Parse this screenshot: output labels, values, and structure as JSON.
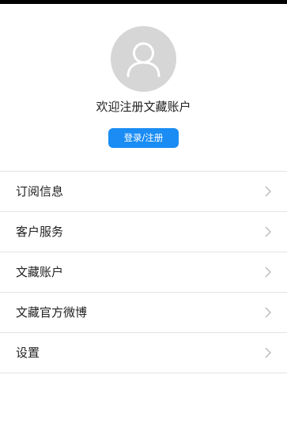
{
  "profile": {
    "avatar_icon": "user-icon",
    "welcome_text": "欢迎注册文藏账户",
    "login_button_label": "登录/注册",
    "accent_color": "#1a8cf3"
  },
  "menu": {
    "items": [
      {
        "label": "订阅信息",
        "icon": "chevron-right-icon"
      },
      {
        "label": "客户服务",
        "icon": "chevron-right-icon"
      },
      {
        "label": "文藏账户",
        "icon": "chevron-right-icon"
      },
      {
        "label": "文藏官方微博",
        "icon": "chevron-right-icon"
      },
      {
        "label": "设置",
        "icon": "chevron-right-icon"
      }
    ]
  }
}
